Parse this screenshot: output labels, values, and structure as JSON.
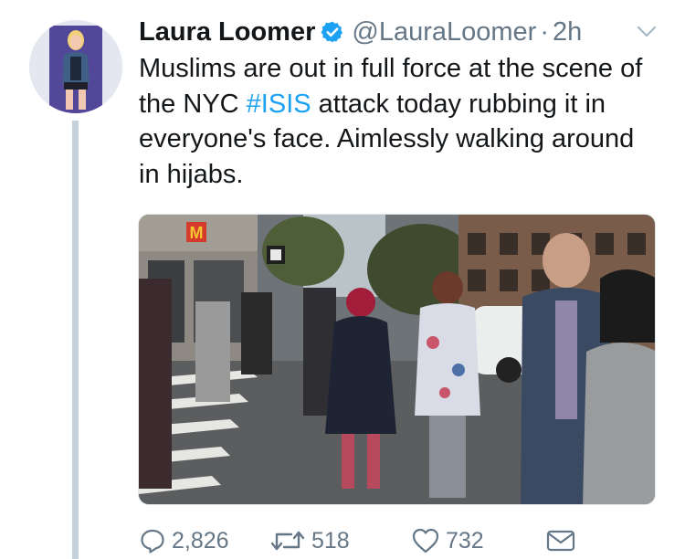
{
  "author": {
    "name": "Laura Loomer",
    "handle": "@LauraLoomer",
    "separator": "·",
    "time": "2h",
    "verified": true,
    "avatar_icon": "avatar-photo"
  },
  "tweet": {
    "text_before": "Muslims are out in full force at the scene of the NYC ",
    "hashtag": "#ISIS",
    "text_after": " attack today rubbing it in everyone's face. Aimlessly walking around in hijabs."
  },
  "media": {
    "signs": [
      "M"
    ]
  },
  "actions": {
    "reply": {
      "icon": "reply-icon",
      "count": "2,826"
    },
    "retweet": {
      "icon": "retweet-icon",
      "count": "518"
    },
    "like": {
      "icon": "heart-icon",
      "count": "732"
    },
    "message": {
      "icon": "envelope-icon"
    }
  },
  "colors": {
    "link": "#1da1f2",
    "secondary_text": "#657786",
    "thread_line": "#c4d0da"
  }
}
